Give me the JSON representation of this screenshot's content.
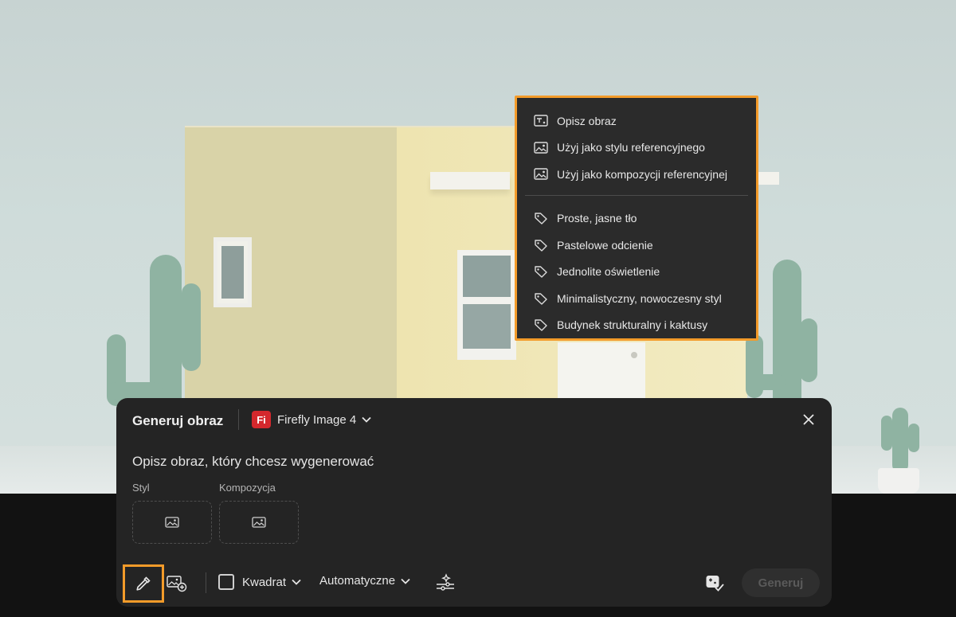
{
  "context_menu": {
    "actions": [
      {
        "label": "Opisz obraz",
        "icon": "describe-image-icon"
      },
      {
        "label": "Użyj jako stylu referencyjnego",
        "icon": "image-icon"
      },
      {
        "label": "Użyj jako kompozycji referencyjnej",
        "icon": "image-icon"
      }
    ],
    "tags": [
      {
        "label": "Proste, jasne tło",
        "icon": "tag-icon"
      },
      {
        "label": "Pastelowe odcienie",
        "icon": "tag-icon"
      },
      {
        "label": "Jednolite oświetlenie",
        "icon": "tag-icon"
      },
      {
        "label": "Minimalistyczny, nowoczesny styl",
        "icon": "tag-icon"
      },
      {
        "label": "Budynek strukturalny i kaktusy",
        "icon": "tag-icon"
      }
    ]
  },
  "panel": {
    "title": "Generuj obraz",
    "model_badge": "Fi",
    "model_name": "Firefly Image 4",
    "prompt_placeholder": "Opisz obraz, który chcesz wygenerować",
    "style_label": "Styl",
    "composition_label": "Kompozycja",
    "aspect_label": "Kwadrat",
    "content_type_label": "Automatyczne",
    "generate_label": "Generuj"
  },
  "colors": {
    "highlight": "#f39b2a",
    "panel_bg": "#242424",
    "menu_bg": "#2b2b2b",
    "model_badge": "#d4282d"
  }
}
